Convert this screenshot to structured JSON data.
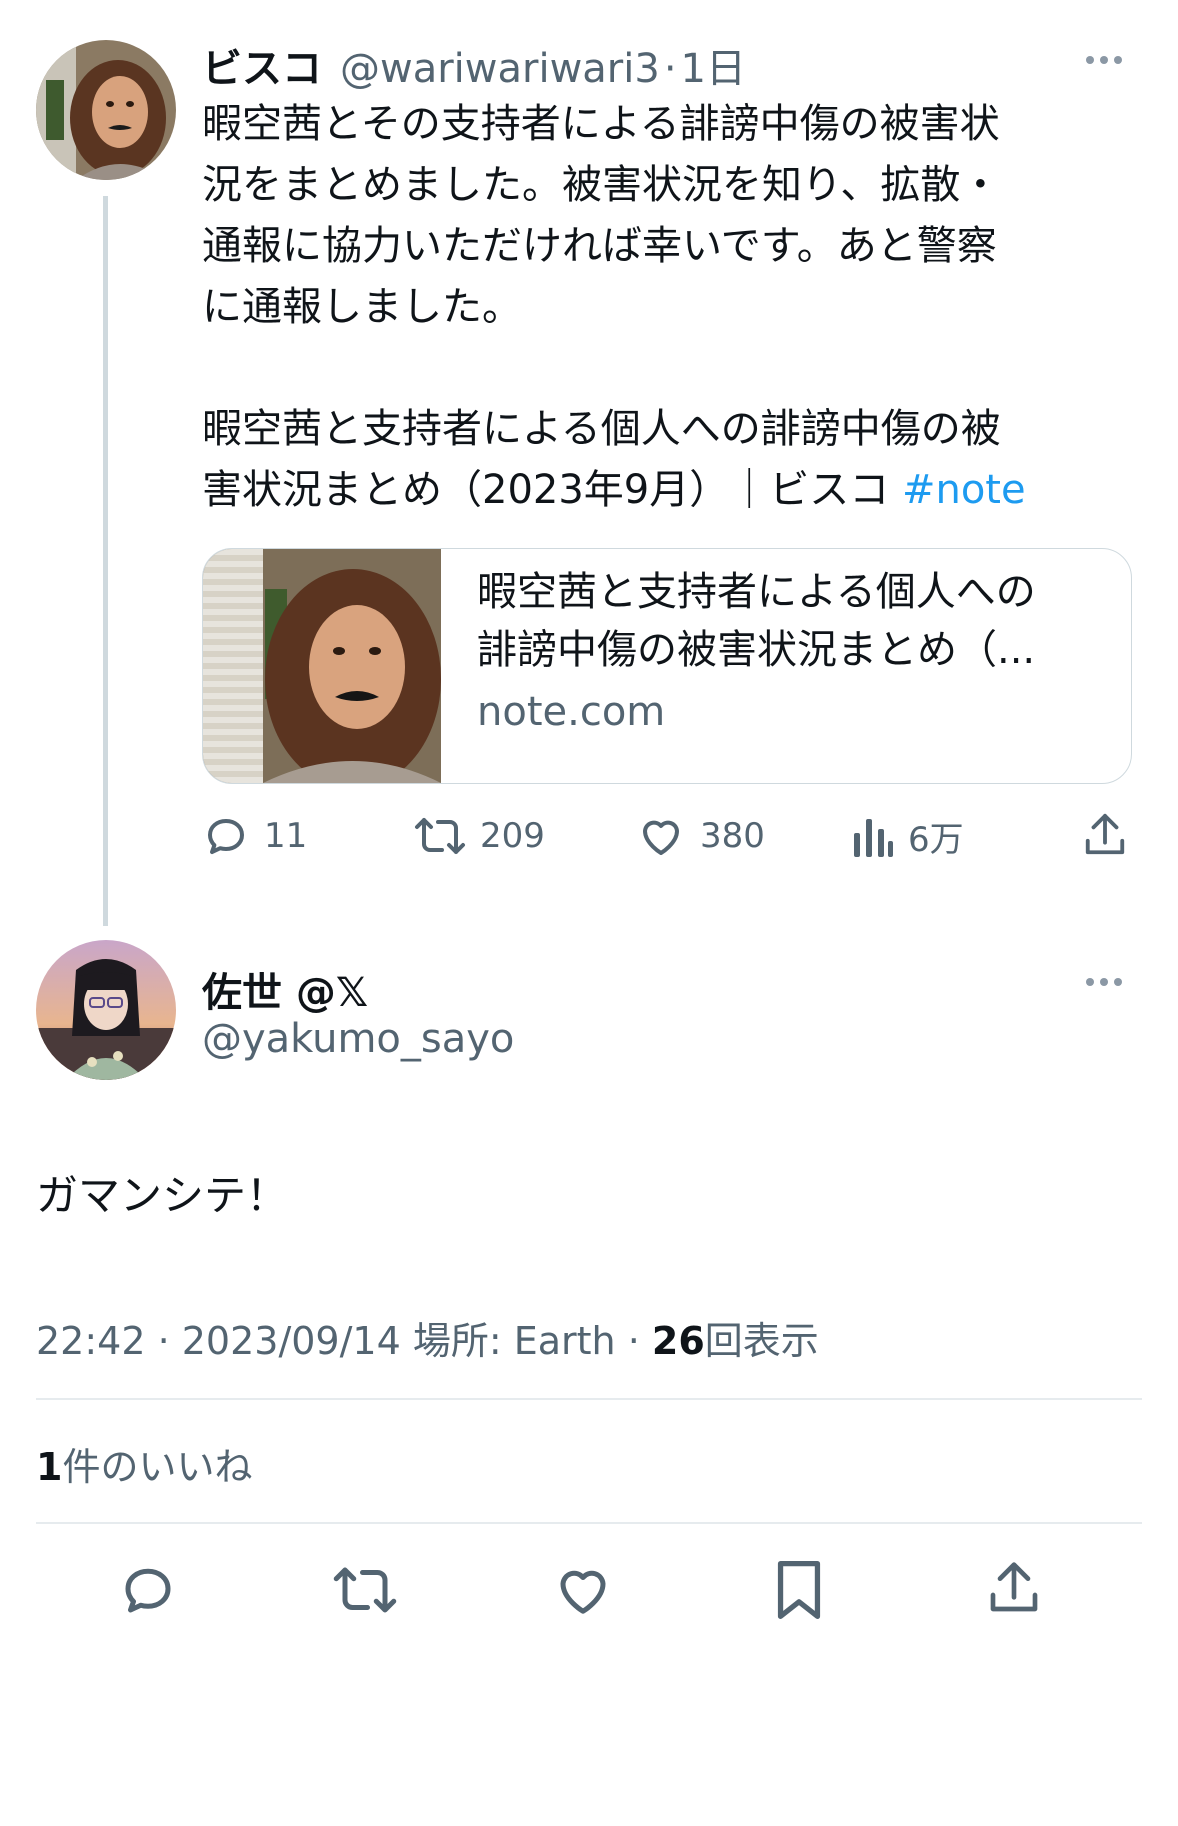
{
  "parent_tweet": {
    "display_name": "ビスコ",
    "handle": "@wariwariwari3",
    "separator": "·",
    "time_ago": "1日",
    "text_lines": [
      "暇空茜とその支持者による誹謗中傷の被害状",
      "況をまとめました。被害状況を知り、拡散・",
      "通報に協力いただければ幸いです。あと警察",
      "に通報しました。"
    ],
    "link_line_1": "暇空茜と支持者による個人への誹謗中傷の被",
    "link_line_2": "害状況まとめ（2023年9月）｜ビスコ ",
    "hashtag": "#note",
    "card": {
      "title_line_1": "暇空茜と支持者による個人への",
      "title_line_2": "誹謗中傷の被害状況まとめ（...",
      "domain": "note.com"
    },
    "actions": {
      "replies": "11",
      "retweets": "209",
      "likes": "380",
      "views": "6万"
    }
  },
  "reply_tweet": {
    "display_name": "佐世 @𝕏",
    "handle": "@yakumo_sayo",
    "text": "ガマンシテ！",
    "timestamp": "22:42 · 2023/09/14 場所: Earth · ",
    "view_count": "26",
    "view_label": "回表示",
    "likes_count": "1",
    "likes_label": "件のいいね"
  },
  "icons": [
    "more-icon",
    "reply-icon",
    "retweet-icon",
    "like-icon",
    "views-icon",
    "share-icon",
    "bookmark-icon"
  ],
  "colors": {
    "hashtag": "#1d9bf0",
    "secondary_text": "#536471",
    "primary_text": "#0f1419",
    "divider": "#e6ebee"
  }
}
